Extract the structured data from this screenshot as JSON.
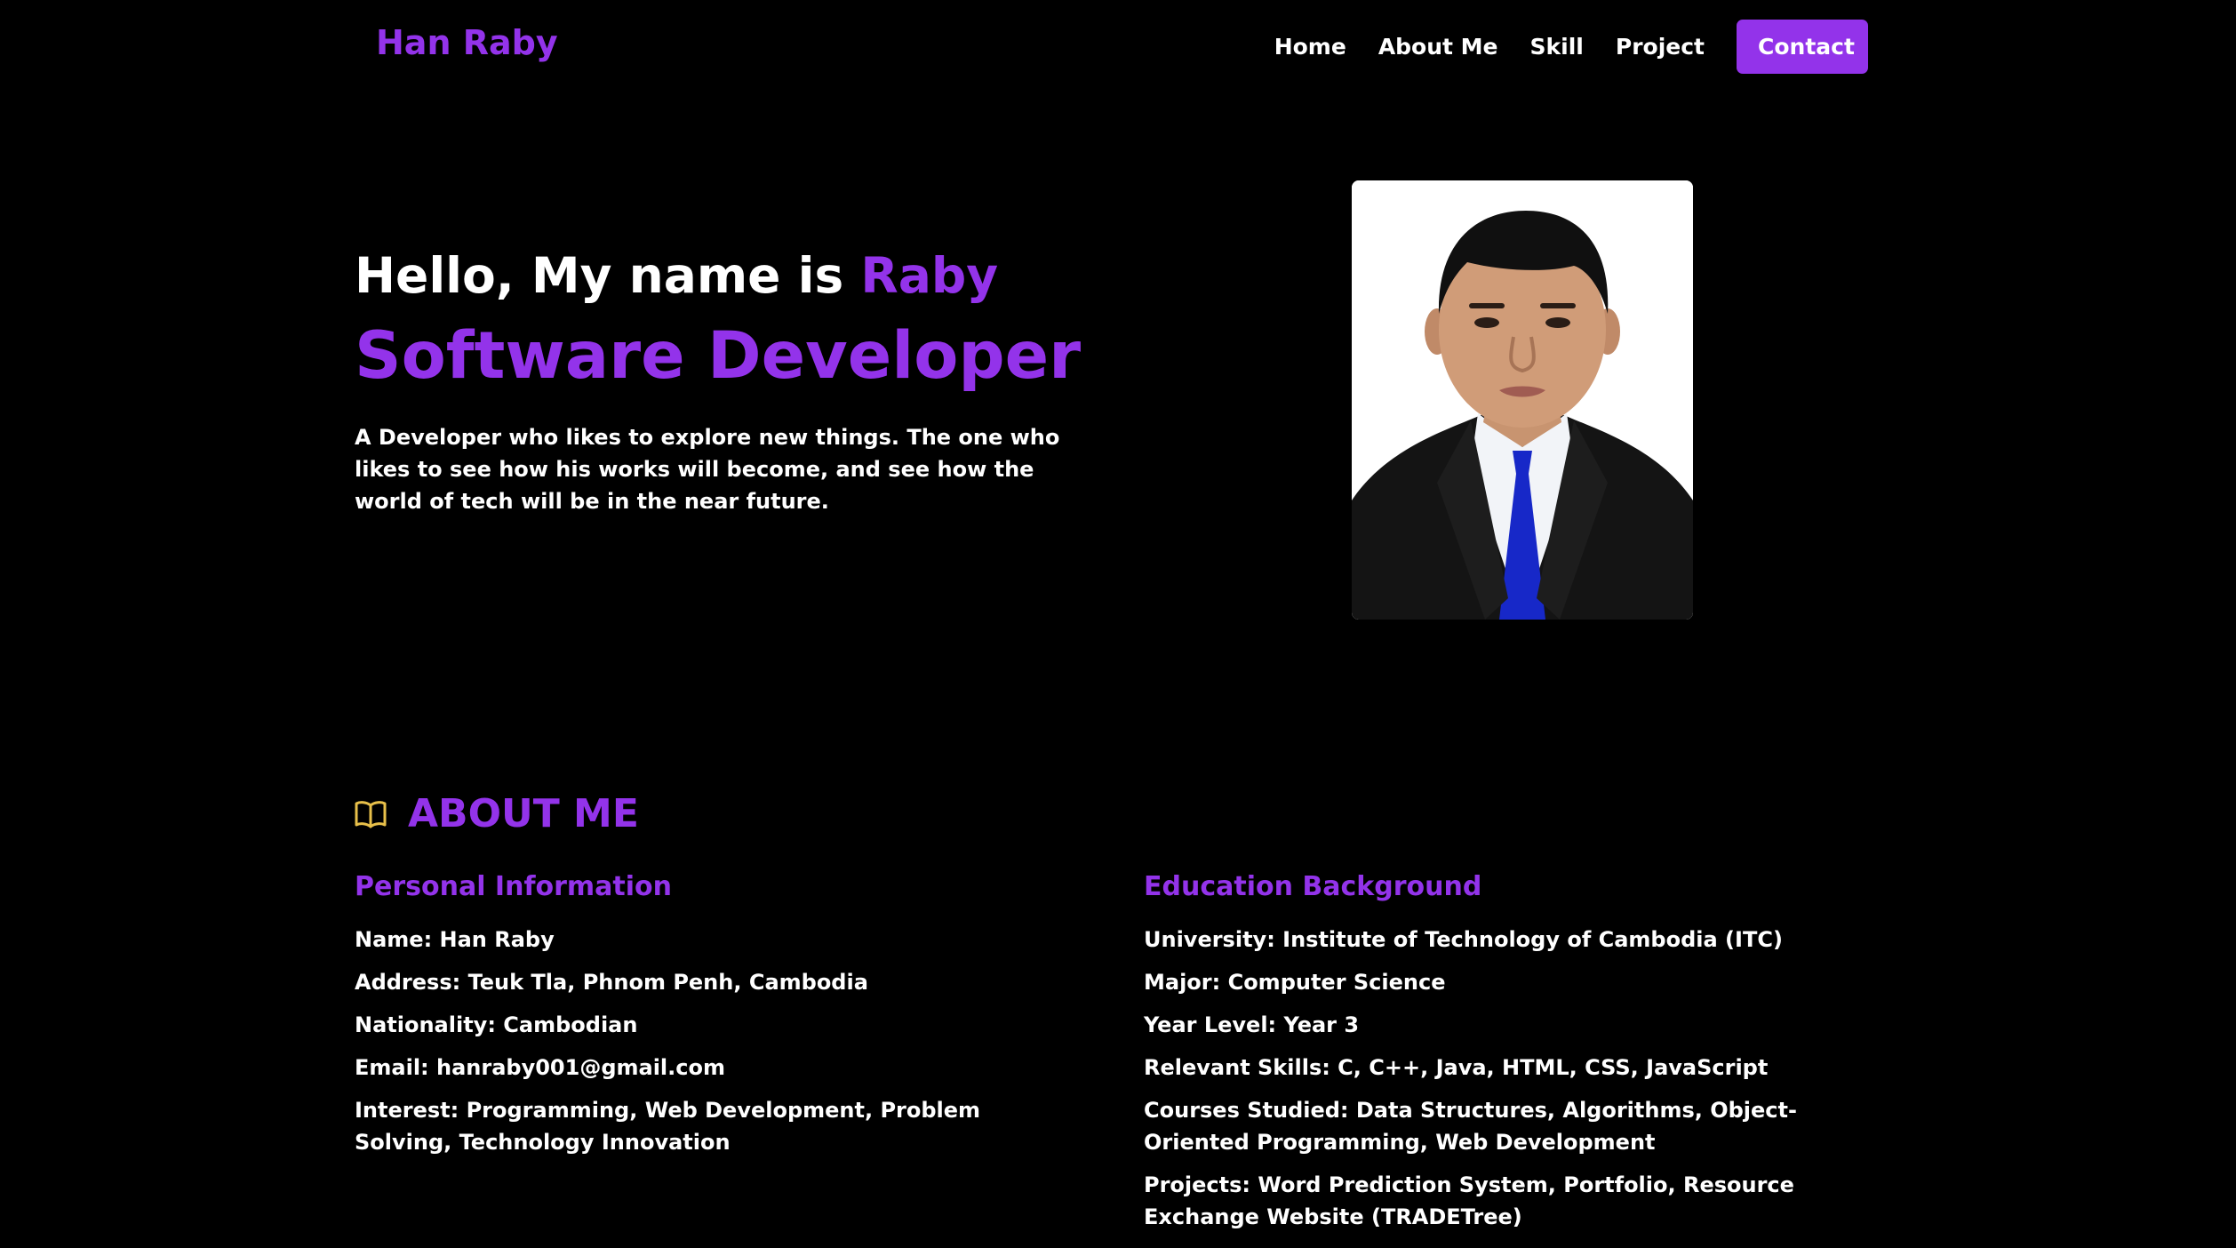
{
  "nav": {
    "brand": "Han Raby",
    "links": [
      "Home",
      "About Me",
      "Skill",
      "Project"
    ],
    "contact_label": "Contact"
  },
  "hero": {
    "greeting_prefix": "Hello, My name is ",
    "greeting_name": "Raby",
    "role": "Software Developer",
    "description": "A Developer who likes to explore new things. The one who likes to see how his works will become, and see how the world of tech will be in the near future."
  },
  "about": {
    "icon": "book-open-icon",
    "title": "ABOUT ME",
    "personal": {
      "title": "Personal Information",
      "items": [
        "Name: Han Raby",
        "Address: Teuk Tla, Phnom Penh, Cambodia",
        "Nationality: Cambodian",
        "Email: hanraby001@gmail.com",
        "Interest: Programming, Web Development, Problem Solving, Technology Innovation"
      ]
    },
    "education": {
      "title": "Education Background",
      "items": [
        "University: Institute of Technology of Cambodia (ITC)",
        "Major: Computer Science",
        "Year Level: Year 3",
        "Relevant Skills: C, C++, Java, HTML, CSS, JavaScript",
        "Courses Studied: Data Structures, Algorithms, Object-Oriented Programming, Web Development",
        "Projects: Word Prediction System, Portfolio, Resource Exchange Website (TRADETree)"
      ]
    }
  },
  "colors": {
    "accent": "#9333ea",
    "background": "#000000",
    "text": "#ffffff",
    "icon": "#e8c04a"
  }
}
